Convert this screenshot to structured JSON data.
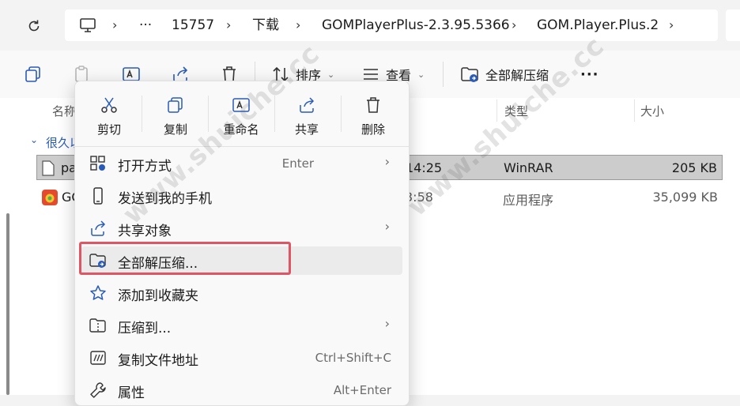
{
  "address": {
    "crumbs": [
      "15757",
      "下载",
      "GOMPlayerPlus-2.3.95.5366",
      "GOM.Player.Plus.2"
    ],
    "ellipsis": "···"
  },
  "toolbar": {
    "sort_label": "排序",
    "view_label": "查看",
    "extract_label": "全部解压缩",
    "more_label": "···"
  },
  "columns": {
    "name": "名称",
    "type": "类型",
    "size": "大小"
  },
  "group": {
    "label": "很久以"
  },
  "files": [
    {
      "name": "pa",
      "time": "14:25",
      "type": "WinRAR",
      "size": "205 KB",
      "selected": true
    },
    {
      "name": "GO",
      "time": "3:58",
      "type": "应用程序",
      "size": "35,099 KB",
      "selected": false
    }
  ],
  "context_menu": {
    "quick_actions": [
      "剪切",
      "复制",
      "重命名",
      "共享",
      "删除"
    ],
    "items": [
      {
        "label": "打开方式",
        "shortcut": "Enter",
        "arrow": "›",
        "icon": "open-with-icon"
      },
      {
        "label": "发送到我的手机",
        "shortcut": "",
        "arrow": "",
        "icon": "phone-icon"
      },
      {
        "label": "共享对象",
        "shortcut": "",
        "arrow": "›",
        "icon": "share-icon"
      },
      {
        "label": "全部解压缩...",
        "shortcut": "",
        "arrow": "",
        "icon": "extract-all-icon"
      },
      {
        "label": "添加到收藏夹",
        "shortcut": "",
        "arrow": "",
        "icon": "star-icon"
      },
      {
        "label": "压缩到...",
        "shortcut": "",
        "arrow": "›",
        "icon": "compress-icon"
      },
      {
        "label": "复制文件地址",
        "shortcut": "Ctrl+Shift+C",
        "arrow": "",
        "icon": "copy-path-icon"
      },
      {
        "label": "属性",
        "shortcut": "Alt+Enter",
        "arrow": "",
        "icon": "wrench-icon"
      }
    ]
  },
  "watermark": {
    "text1": "www.shuiche.cc",
    "text2": "www.shuiche.cc"
  },
  "colors": {
    "highlight": "#e05563",
    "selected_row": "#cccccc",
    "accent": "#2a5bb8"
  }
}
